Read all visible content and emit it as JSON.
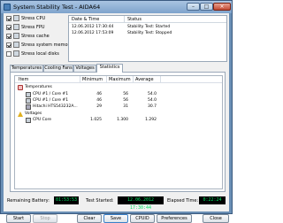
{
  "window": {
    "title": "System Stability Test - AIDA64"
  },
  "titlebar_buttons": {
    "minimize": "–",
    "maximize": "□",
    "close": "×"
  },
  "stress": [
    {
      "label": "Stress CPU",
      "checked": true
    },
    {
      "label": "Stress FPU",
      "checked": true
    },
    {
      "label": "Stress cache",
      "checked": true
    },
    {
      "label": "Stress system memory",
      "checked": true
    },
    {
      "label": "Stress local disks",
      "checked": false
    }
  ],
  "log": {
    "columns": [
      "Date & Time",
      "Status"
    ],
    "rows": [
      {
        "datetime": "12.06.2012 17:30:44",
        "status": "Stability Test: Started"
      },
      {
        "datetime": "12.06.2012 17:53:09",
        "status": "Stability Test: Stopped"
      }
    ]
  },
  "tabs": [
    {
      "label": "Temperatures",
      "active": false
    },
    {
      "label": "Cooling Fans",
      "active": false
    },
    {
      "label": "Voltages",
      "active": false
    },
    {
      "label": "Statistics",
      "active": true
    }
  ],
  "statistics": {
    "columns": [
      "Item",
      "Minimum",
      "Maximum",
      "Average"
    ],
    "groups": [
      {
        "name": "Temperatures",
        "icon": "thermometer-icon",
        "items": [
          {
            "name": "CPU #1 / Core #1",
            "icon": "cpu-icon",
            "min": "46",
            "max": "56",
            "avg": "54.0"
          },
          {
            "name": "CPU #1 / Core #1",
            "icon": "cpu-icon",
            "min": "46",
            "max": "56",
            "avg": "54.0"
          },
          {
            "name": "Hitachi HTS543232A...",
            "icon": "hdd-icon",
            "min": "29",
            "max": "31",
            "avg": "30.7"
          }
        ]
      },
      {
        "name": "Voltages",
        "icon": "voltage-icon",
        "items": [
          {
            "name": "CPU Core",
            "icon": "cpu-icon",
            "min": "1.025",
            "max": "1.300",
            "avg": "1.292"
          }
        ]
      }
    ]
  },
  "status": {
    "battery_label": "Remaining Battery:",
    "battery_value": "01:53:53",
    "started_label": "Test Started:",
    "started_value": "12.06.2012 17:30:44",
    "elapsed_label": "Elapsed Time:",
    "elapsed_value": "0:22:24"
  },
  "buttons": {
    "start": "Start",
    "stop": "Stop",
    "clear": "Clear",
    "save": "Save",
    "cpuid": "CPUID",
    "preferences": "Preferences",
    "close": "Close"
  },
  "colors": {
    "lcd_text": "#00e060",
    "lcd_bg": "#000000",
    "titlebar": "#7ea3cc"
  }
}
